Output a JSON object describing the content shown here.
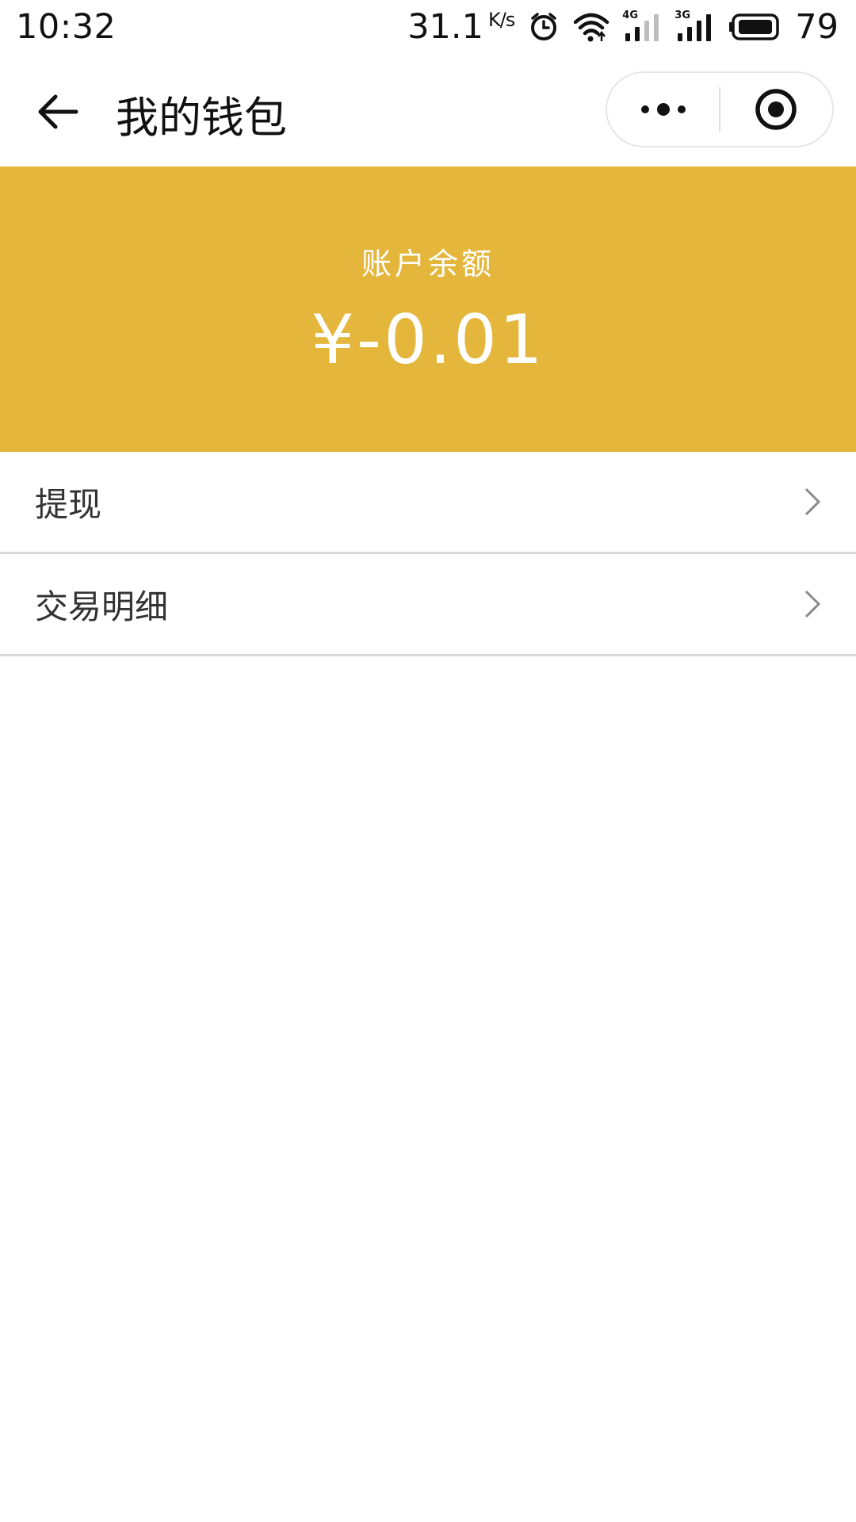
{
  "status_bar": {
    "time": "10:32",
    "net_speed": "31.1",
    "net_speed_unit": "K/s",
    "signal1_tag": "4G",
    "signal2_tag": "3G",
    "battery_percent": "79",
    "icons": [
      "alarm-icon",
      "wifi-icon",
      "signal-icon",
      "battery-icon"
    ]
  },
  "nav": {
    "title": "我的钱包",
    "back_icon": "back-arrow-icon",
    "more_icon": "more-dots-icon",
    "close_icon": "target-close-icon"
  },
  "balance": {
    "label": "账户余额",
    "amount": "¥-0.01",
    "background_color": "#e4b63c"
  },
  "menu": {
    "items": [
      {
        "label": "提现",
        "icon": "chevron-right-icon"
      },
      {
        "label": "交易明细",
        "icon": "chevron-right-icon"
      }
    ]
  }
}
